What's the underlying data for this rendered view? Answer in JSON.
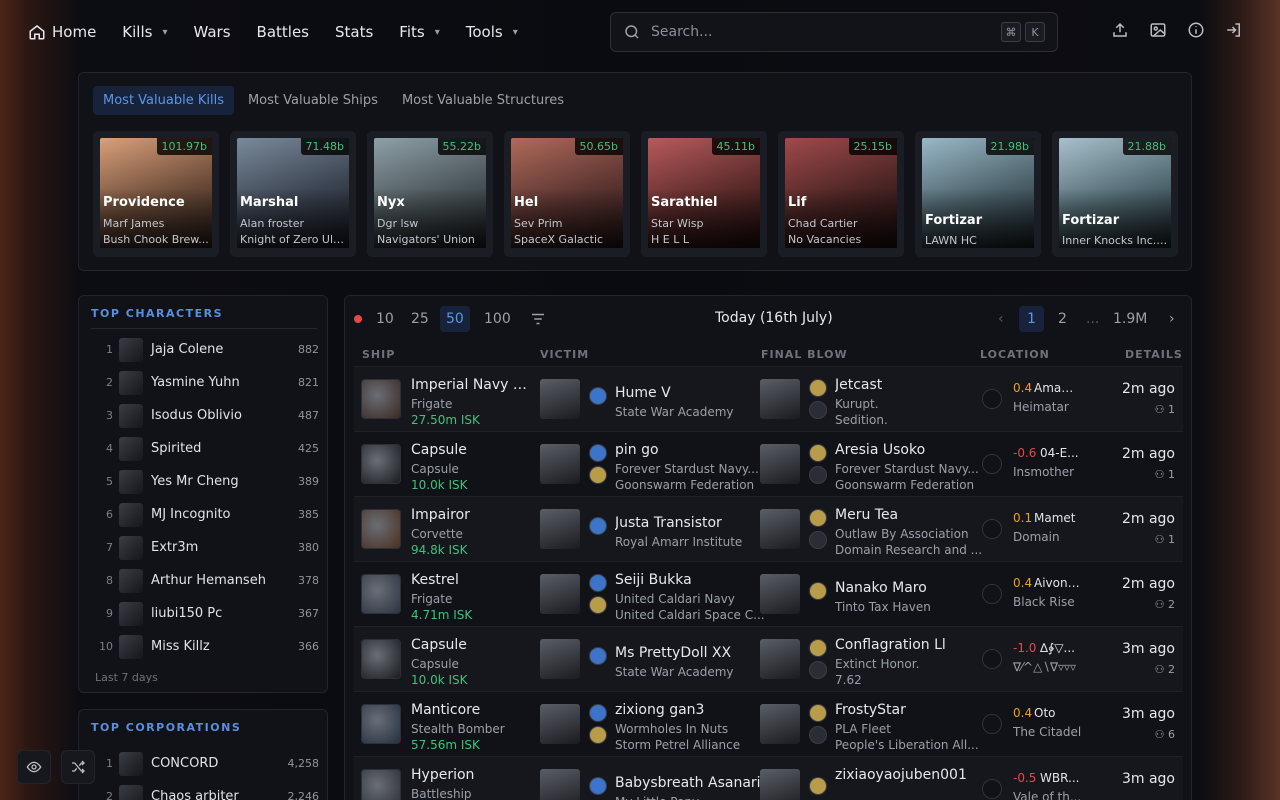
{
  "nav": {
    "home": "Home",
    "kills": "Kills",
    "wars": "Wars",
    "battles": "Battles",
    "stats": "Stats",
    "fits": "Fits",
    "tools": "Tools"
  },
  "search": {
    "placeholder": "Search...",
    "kbd": [
      "⌘",
      "K"
    ]
  },
  "mvk": {
    "tabs": [
      "Most Valuable Kills",
      "Most Valuable Ships",
      "Most Valuable Structures"
    ],
    "cards": [
      {
        "value": "101.97b",
        "ship": "Providence",
        "l1": "Marf James",
        "l2": "Bush Chook Brew..."
      },
      {
        "value": "71.48b",
        "ship": "Marshal",
        "l1": "Alan froster",
        "l2": "Knight of Zero Ultra"
      },
      {
        "value": "55.22b",
        "ship": "Nyx",
        "l1": "Dgr lsw",
        "l2": "Navigators' Union"
      },
      {
        "value": "50.65b",
        "ship": "Hel",
        "l1": "Sev Prim",
        "l2": "SpaceX Galactic"
      },
      {
        "value": "45.11b",
        "ship": "Sarathiel",
        "l1": "Star Wisp",
        "l2": "H E L L"
      },
      {
        "value": "25.15b",
        "ship": "Lif",
        "l1": "Chad Cartier",
        "l2": "No Vacancies"
      },
      {
        "value": "21.98b",
        "ship": "Fortizar",
        "l1": "LAWN HC",
        "l2": ""
      },
      {
        "value": "21.88b",
        "ship": "Fortizar",
        "l1": "Inner Knocks Inc. ...",
        "l2": ""
      }
    ]
  },
  "top_characters": {
    "title": "TOP CHARACTERS",
    "footer": "Last 7 days",
    "items": [
      {
        "rank": "1",
        "name": "Jaja Colene",
        "count": "882"
      },
      {
        "rank": "2",
        "name": "Yasmine Yuhn",
        "count": "821"
      },
      {
        "rank": "3",
        "name": "Isodus Oblivio",
        "count": "487"
      },
      {
        "rank": "4",
        "name": "Spirited",
        "count": "425"
      },
      {
        "rank": "5",
        "name": "Yes Mr Cheng",
        "count": "389"
      },
      {
        "rank": "6",
        "name": "MJ Incognito",
        "count": "385"
      },
      {
        "rank": "7",
        "name": "Extr3m",
        "count": "380"
      },
      {
        "rank": "8",
        "name": "Arthur Hemanseh",
        "count": "378"
      },
      {
        "rank": "9",
        "name": "liubi150 Pc",
        "count": "367"
      },
      {
        "rank": "10",
        "name": "Miss Killz",
        "count": "366"
      }
    ]
  },
  "top_corporations": {
    "title": "TOP CORPORATIONS",
    "items": [
      {
        "rank": "1",
        "name": "CONCORD",
        "count": "4,258"
      },
      {
        "rank": "2",
        "name": "Chaos arbiter",
        "count": "2,246"
      }
    ]
  },
  "killlist": {
    "sizes": [
      "10",
      "25",
      "50",
      "100"
    ],
    "active_size": "50",
    "date": "Today (16th July)",
    "pages": [
      "1",
      "2",
      "...",
      "1.9M"
    ],
    "headers": {
      "ship": "SHIP",
      "victim": "VICTIM",
      "final_blow": "FINAL BLOW",
      "location": "LOCATION",
      "details": "DETAILS"
    },
    "rows": [
      {
        "ship": "Imperial Navy Sl...",
        "class": "Frigate",
        "isk": "27.50m ISK",
        "victim": "Hume V",
        "v1": "State War Academy",
        "v2": "",
        "fb": "Jetcast",
        "f1": "Kurupt.",
        "f2": "Sedition.",
        "sec": "0.4",
        "sec_color": "#e6a21a",
        "system": "Amam...",
        "region": "Heimatar",
        "ago": "2m ago",
        "inv": "1"
      },
      {
        "ship": "Capsule",
        "class": "Capsule",
        "isk": "10.0k ISK",
        "victim": "pin go",
        "v1": "Forever Stardust Navy...",
        "v2": "Goonswarm Federation",
        "fb": "Aresia Usoko",
        "f1": "Forever Stardust Navy...",
        "f2": "Goonswarm Federation",
        "sec": "-0.6",
        "sec_color": "#e24a4a",
        "system": "04-E...",
        "region": "Insmother",
        "ago": "2m ago",
        "inv": "1"
      },
      {
        "ship": "Impairor",
        "class": "Corvette",
        "isk": "94.8k ISK",
        "victim": "Justa Transistor",
        "v1": "Royal Amarr Institute",
        "v2": "",
        "fb": "Meru Tea",
        "f1": "Outlaw By Association",
        "f2": "Domain Research and ...",
        "sec": "0.1",
        "sec_color": "#e6a21a",
        "system": "Mamet",
        "region": "Domain",
        "ago": "2m ago",
        "inv": "1"
      },
      {
        "ship": "Kestrel",
        "class": "Frigate",
        "isk": "4.71m ISK",
        "victim": "Seiji Bukka",
        "v1": "United Caldari Navy",
        "v2": "United Caldari Space C...",
        "fb": "Nanako Maro",
        "f1": "Tinto Tax Haven",
        "f2": "",
        "sec": "0.4",
        "sec_color": "#e6a21a",
        "system": "Aivonen",
        "region": "Black Rise",
        "ago": "2m ago",
        "inv": "2"
      },
      {
        "ship": "Capsule",
        "class": "Capsule",
        "isk": "10.0k ISK",
        "victim": "Ms PrettyDoll XX",
        "v1": "State War Academy",
        "v2": "",
        "fb": "Conflagration Ll",
        "f1": "Extinct Honor.",
        "f2": "7.62",
        "sec": "-1.0",
        "sec_color": "#e24a4a",
        "system": "∆∳▽...",
        "region": "∇⁄^△∖∇▿▿▿",
        "ago": "3m ago",
        "inv": "2"
      },
      {
        "ship": "Manticore",
        "class": "Stealth Bomber",
        "isk": "57.56m ISK",
        "victim": "zixiong gan3",
        "v1": "Wormholes In Nuts",
        "v2": "Storm Petrel Alliance",
        "fb": "FrostyStar",
        "f1": "PLA Fleet",
        "f2": "People's Liberation All...",
        "sec": "0.4",
        "sec_color": "#e6a21a",
        "system": "Oto",
        "region": "The Citadel",
        "ago": "3m ago",
        "inv": "6"
      },
      {
        "ship": "Hyperion",
        "class": "Battleship",
        "isk": "",
        "victim": "Babysbreath Asanari",
        "v1": "My Little Pony.",
        "v2": "",
        "fb": "zixiaoyaojuben001",
        "f1": "",
        "f2": "",
        "sec": "-0.5",
        "sec_color": "#e24a4a",
        "system": "WBR...",
        "region": "Vale of th...",
        "ago": "3m ago",
        "inv": ""
      }
    ]
  },
  "colors": {
    "accent": "#5d95e8",
    "isk": "#41c27a",
    "background": "#0a0b10"
  },
  "icons": [
    "home-icon",
    "search-icon",
    "upload-icon",
    "image-icon",
    "info-icon",
    "login-icon",
    "filter-icon",
    "eye-icon",
    "shuffle-icon"
  ]
}
